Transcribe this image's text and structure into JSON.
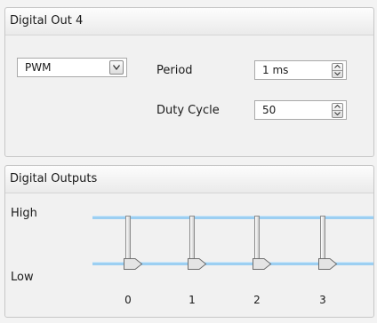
{
  "digital_out": {
    "title": "Digital Out 4",
    "mode": "PWM",
    "period_label": "Period",
    "period_value": "1 ms",
    "duty_label": "Duty Cycle",
    "duty_value": "50"
  },
  "digital_outputs": {
    "title": "Digital Outputs",
    "high_label": "High",
    "low_label": "Low",
    "channels": [
      {
        "label": "0",
        "state": "Low"
      },
      {
        "label": "1",
        "state": "Low"
      },
      {
        "label": "2",
        "state": "Low"
      },
      {
        "label": "3",
        "state": "Low"
      }
    ]
  },
  "colors": {
    "level_line": "#9ccff2",
    "panel_border": "#c7c7c7"
  }
}
